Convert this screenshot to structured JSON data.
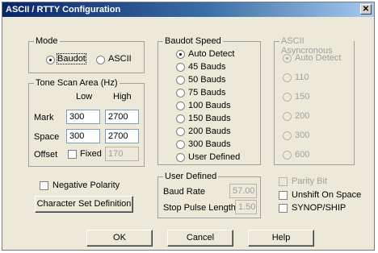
{
  "window": {
    "title": "ASCII / RTTY Configuration",
    "close_glyph": "✕"
  },
  "mode": {
    "title": "Mode",
    "options": [
      {
        "label": "Baudot",
        "selected": true
      },
      {
        "label": "ASCII",
        "selected": false
      }
    ]
  },
  "tone_scan": {
    "title": "Tone Scan Area (Hz)",
    "low_header": "Low",
    "high_header": "High",
    "mark_label": "Mark",
    "mark_low": "300",
    "mark_high": "2700",
    "space_label": "Space",
    "space_low": "300",
    "space_high": "2700",
    "offset_label": "Offset",
    "fixed_label": "Fixed",
    "offset_value": "170"
  },
  "baudot_speed": {
    "title": "Baudot Speed",
    "options": [
      {
        "label": "Auto Detect",
        "selected": true
      },
      {
        "label": "45 Bauds",
        "selected": false
      },
      {
        "label": "50 Bauds",
        "selected": false
      },
      {
        "label": "75 Bauds",
        "selected": false
      },
      {
        "label": "100 Bauds",
        "selected": false
      },
      {
        "label": "150 Bauds",
        "selected": false
      },
      {
        "label": "200 Bauds",
        "selected": false
      },
      {
        "label": "300 Bauds",
        "selected": false
      },
      {
        "label": "User Defined",
        "selected": false
      }
    ]
  },
  "ascii_async": {
    "title": "ASCII Asyncronous",
    "options": [
      {
        "label": "Auto Detect",
        "selected": true
      },
      {
        "label": "110",
        "selected": false
      },
      {
        "label": "150",
        "selected": false
      },
      {
        "label": "200",
        "selected": false
      },
      {
        "label": "300",
        "selected": false
      },
      {
        "label": "600",
        "selected": false
      }
    ]
  },
  "user_defined": {
    "title": "User Defined",
    "baud_rate_label": "Baud Rate",
    "baud_rate_value": "57.00",
    "stop_pulse_label": "Stop Pulse Length",
    "stop_pulse_value": "1.50"
  },
  "options": {
    "negative_polarity": "Negative Polarity",
    "parity_bit": "Parity Bit",
    "unshift_on_space": "Unshift On Space",
    "synop_ship": "SYNOP/SHIP"
  },
  "buttons": {
    "charset": "Character Set Definition",
    "ok": "OK",
    "cancel": "Cancel",
    "help": "Help"
  }
}
